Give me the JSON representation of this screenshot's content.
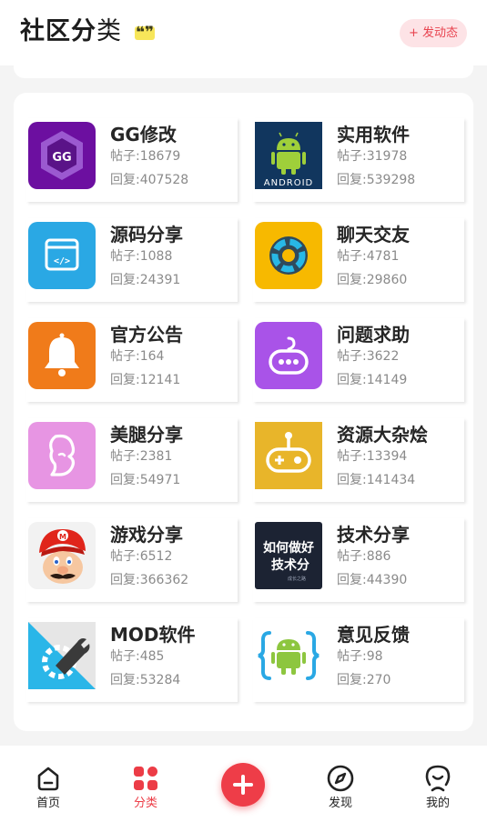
{
  "header": {
    "title_bold": "社区分",
    "title_light": "类",
    "quote_glyph": "❝❞",
    "post_button_label": "+ 发动态"
  },
  "categories": [
    {
      "name": "GG修改",
      "posts": "帖子:18679",
      "replies": "回复:407528",
      "icon": "gg-hexagon-icon"
    },
    {
      "name": "实用软件",
      "posts": "帖子:31978",
      "replies": "回复:539298",
      "icon": "android-robot-icon",
      "icon_text": "ANDROID"
    },
    {
      "name": "源码分享",
      "posts": "帖子:1088",
      "replies": "回复:24391",
      "icon": "code-window-icon"
    },
    {
      "name": "聊天交友",
      "posts": "帖子:4781",
      "replies": "回复:29860",
      "icon": "aperture-ring-icon"
    },
    {
      "name": "官方公告",
      "posts": "帖子:164",
      "replies": "回复:12141",
      "icon": "bell-icon"
    },
    {
      "name": "问题求助",
      "posts": "帖子:3622",
      "replies": "回复:14149",
      "icon": "gamepad-icon"
    },
    {
      "name": "美腿分享",
      "posts": "帖子:2381",
      "replies": "回复:54971",
      "icon": "woman-silhouette-icon"
    },
    {
      "name": "资源大杂烩",
      "posts": "帖子:13394",
      "replies": "回复:141434",
      "icon": "joystick-icon"
    },
    {
      "name": "游戏分享",
      "posts": "帖子:6512",
      "replies": "回复:366362",
      "icon": "mario-face-icon"
    },
    {
      "name": "技术分享",
      "posts": "帖子:886",
      "replies": "回复:44390",
      "icon": "tech-banner-icon",
      "icon_text": [
        "如何做好",
        "技术分",
        "成长之路"
      ]
    },
    {
      "name": "MOD软件",
      "posts": "帖子:485",
      "replies": "回复:53284",
      "icon": "wrench-gear-icon"
    },
    {
      "name": "意见反馈",
      "posts": "帖子:98",
      "replies": "回复:270",
      "icon": "android-braces-icon"
    }
  ],
  "tabbar": {
    "home": "首页",
    "category": "分类",
    "discover": "发现",
    "mine": "我的"
  },
  "colors": {
    "accent": "#ec3c46",
    "post_button_bg": "#fde3e6",
    "page_bg": "#f4f4f4"
  }
}
